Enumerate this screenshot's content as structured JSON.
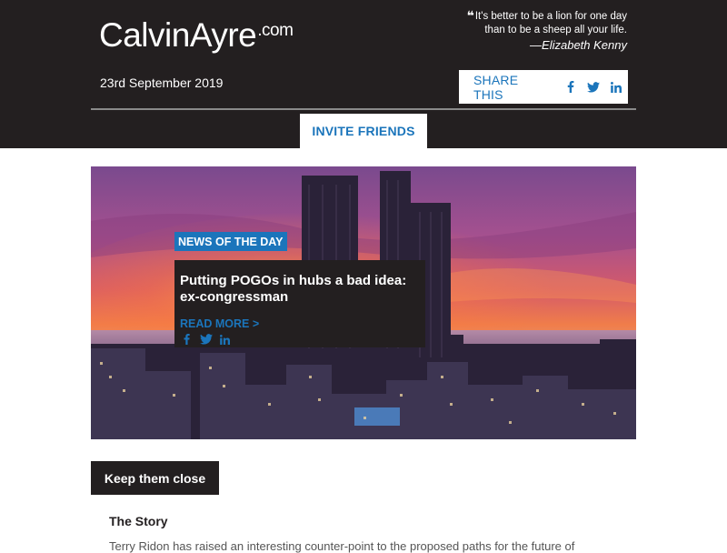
{
  "header": {
    "logo_main": "CalvinAyre",
    "logo_suffix": ".com",
    "quote_mark": "❝",
    "quote_line1": "It's better to be a lion for one day",
    "quote_line2": "than to be a sheep all your life.",
    "quote_author": "—Elizabeth Kenny",
    "date": "23rd September 2019",
    "share_label": "SHARE THIS",
    "share_icons": [
      "facebook-icon",
      "twitter-icon",
      "linkedin-icon"
    ],
    "invite_label": "INVITE FRIENDS"
  },
  "hero": {
    "badge": "NEWS OF THE DAY",
    "title": "Putting POGOs in hubs a bad idea: ex-congressman",
    "read_more": "READ MORE >",
    "social_icons": [
      "facebook-icon",
      "twitter-icon",
      "linkedin-icon"
    ]
  },
  "section": {
    "tag": "Keep them close",
    "story_title": "The Story",
    "story_body": "Terry Ridon has raised an interesting counter-point to the proposed paths for the future of"
  },
  "colors": {
    "header_bg": "#231f20",
    "accent_blue": "#1b75bb",
    "white": "#ffffff"
  }
}
